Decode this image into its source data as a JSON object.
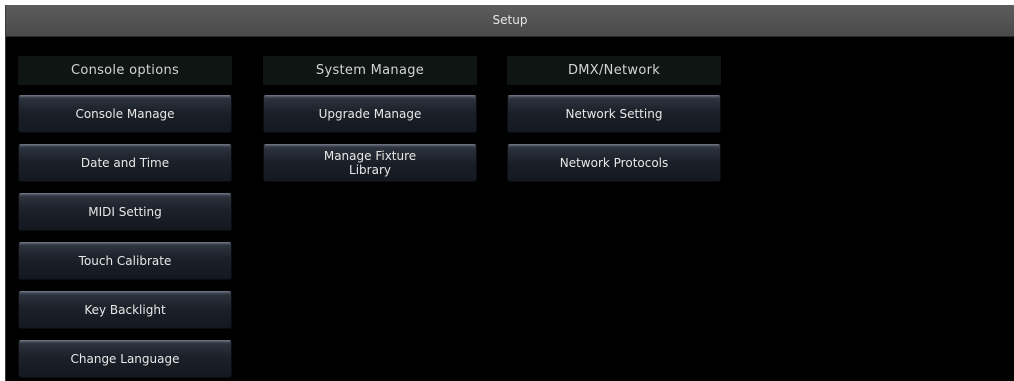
{
  "window": {
    "title": "Setup"
  },
  "columns": [
    {
      "header": "Console options",
      "buttons": [
        "Console Manage",
        "Date and Time",
        "MIDI Setting",
        "Touch Calibrate",
        "Key Backlight",
        "Change Language"
      ]
    },
    {
      "header": "System Manage",
      "buttons": [
        "Upgrade Manage",
        "Manage Fixture Library"
      ]
    },
    {
      "header": "DMX/Network",
      "buttons": [
        "Network Setting",
        "Network Protocols"
      ]
    }
  ],
  "colors": {
    "background": "#000000",
    "titlebar": "#505050",
    "header_bg": "#0f1512",
    "button_top": "#4a5260",
    "button_bottom": "#141820",
    "text": "#e8e8e8"
  }
}
